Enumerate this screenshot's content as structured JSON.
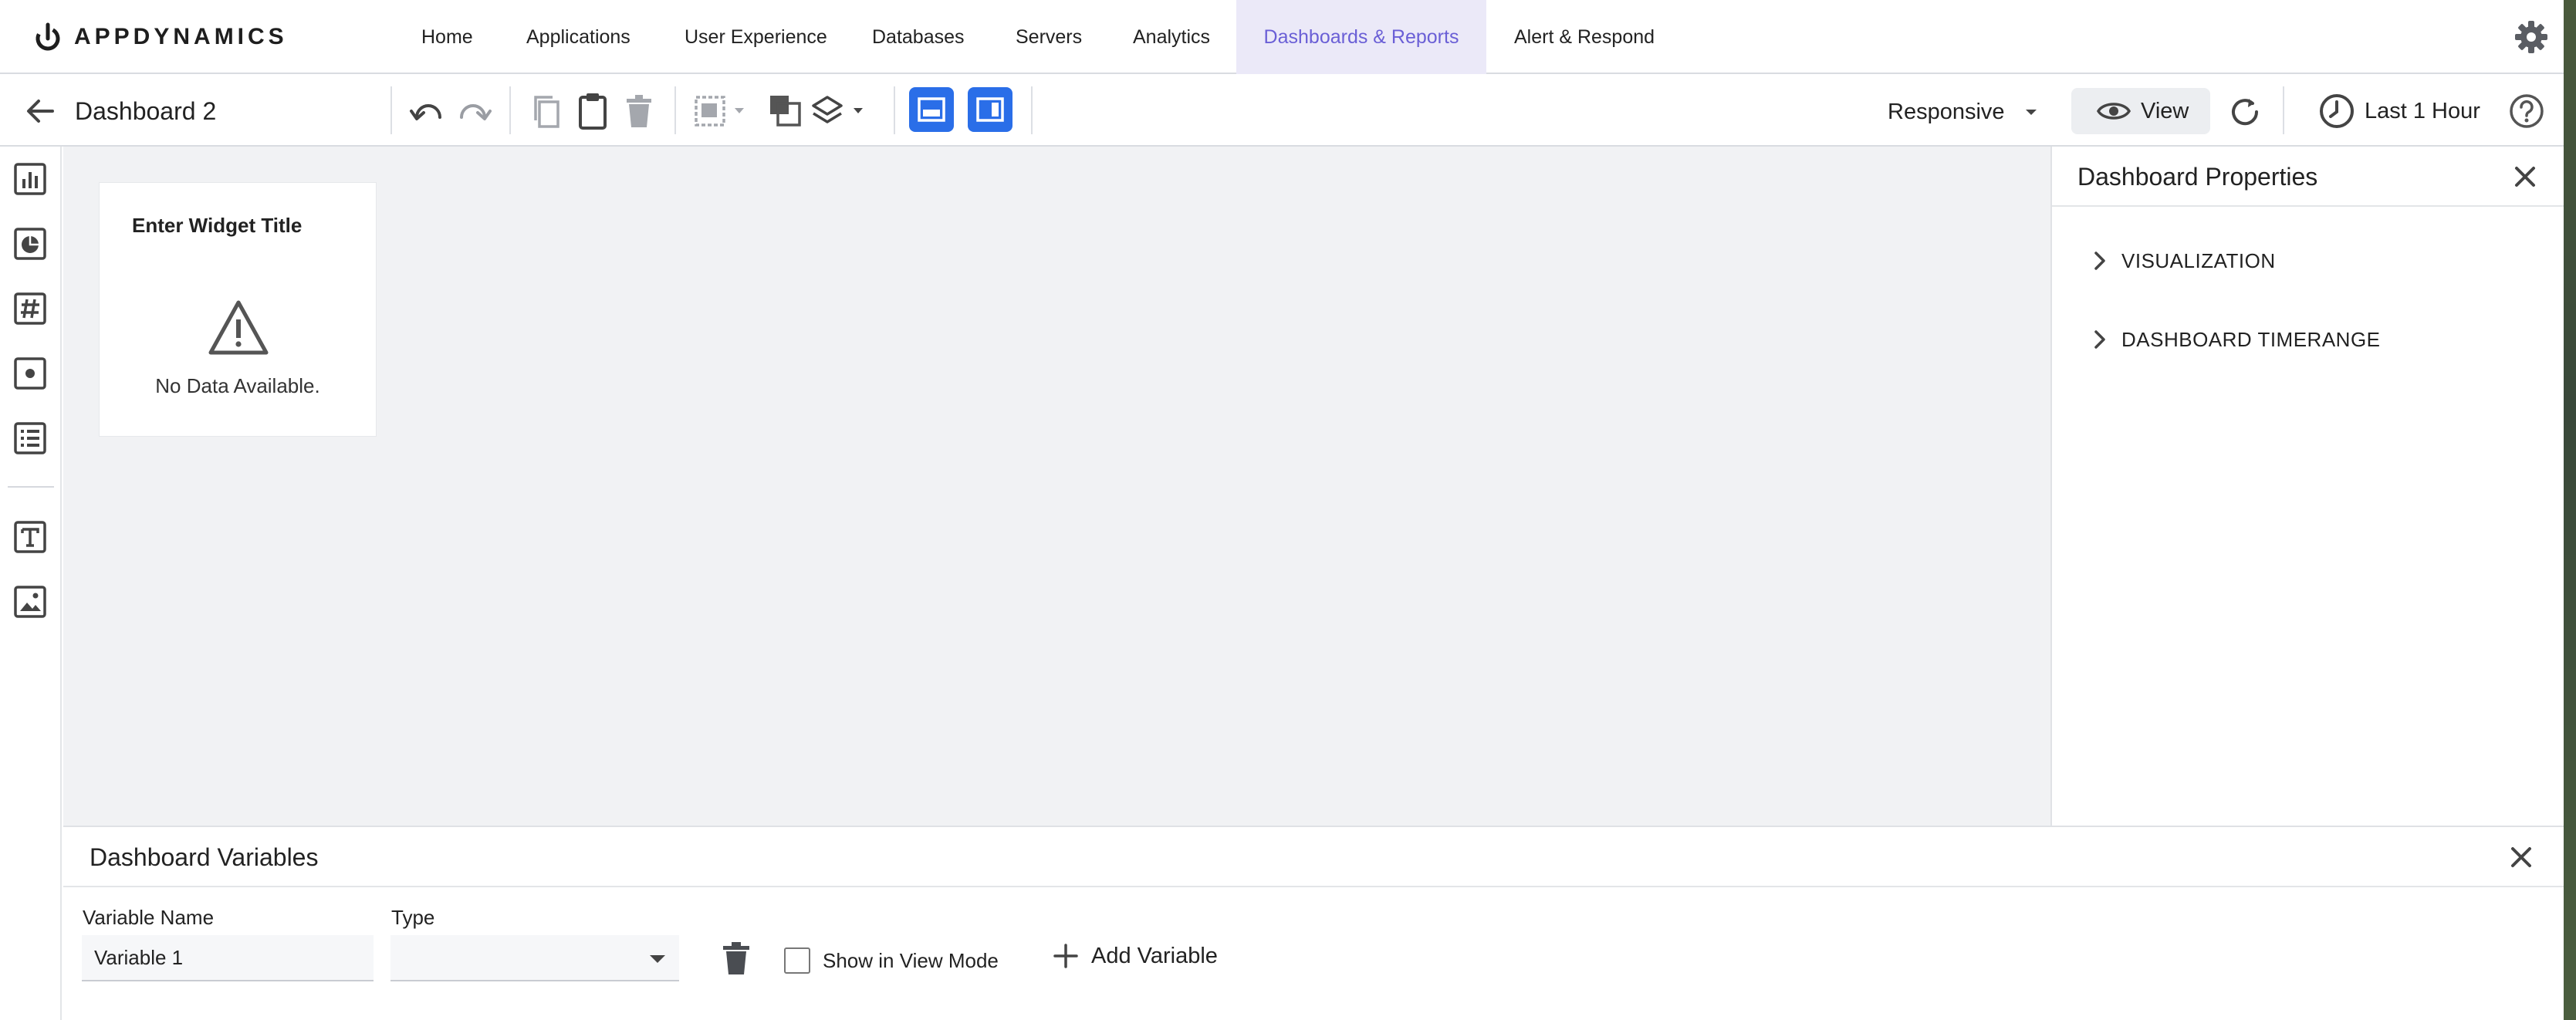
{
  "brand": {
    "name": "APPDYNAMICS"
  },
  "nav": {
    "items": [
      {
        "label": "Home"
      },
      {
        "label": "Applications"
      },
      {
        "label": "User Experience"
      },
      {
        "label": "Databases"
      },
      {
        "label": "Servers"
      },
      {
        "label": "Analytics"
      },
      {
        "label": "Dashboards & Reports",
        "active": true
      },
      {
        "label": "Alert & Respond"
      }
    ],
    "active_color": "#6a5fd6"
  },
  "toolbar": {
    "title": "Dashboard 2",
    "layout_mode": "Responsive",
    "view_label": "View",
    "time_range": "Last 1 Hour",
    "accent_color": "#2a6ee8",
    "icons": [
      "back-arrow-icon",
      "undo-icon",
      "redo-icon",
      "copy-icon",
      "paste-icon",
      "delete-icon",
      "group-icon",
      "crop-icon",
      "layers-icon",
      "layout-full-icon",
      "layout-side-panel-icon",
      "eye-icon",
      "refresh-icon",
      "clock-icon",
      "help-icon"
    ]
  },
  "palette": {
    "icons": [
      "bar-chart-widget-icon",
      "pie-chart-widget-icon",
      "metric-value-widget-icon",
      "status-widget-icon",
      "list-widget-icon",
      "text-widget-icon",
      "image-widget-icon"
    ]
  },
  "widget": {
    "title": "Enter Widget Title",
    "message": "No Data Available."
  },
  "properties": {
    "title": "Dashboard Properties",
    "sections": [
      {
        "label": "VISUALIZATION"
      },
      {
        "label": "DASHBOARD TIMERANGE"
      }
    ]
  },
  "variables": {
    "title": "Dashboard Variables",
    "name_label": "Variable Name",
    "type_label": "Type",
    "rows": [
      {
        "name": "Variable 1",
        "type": ""
      }
    ],
    "show_in_view_label": "Show in View Mode",
    "add_label": "Add Variable"
  }
}
